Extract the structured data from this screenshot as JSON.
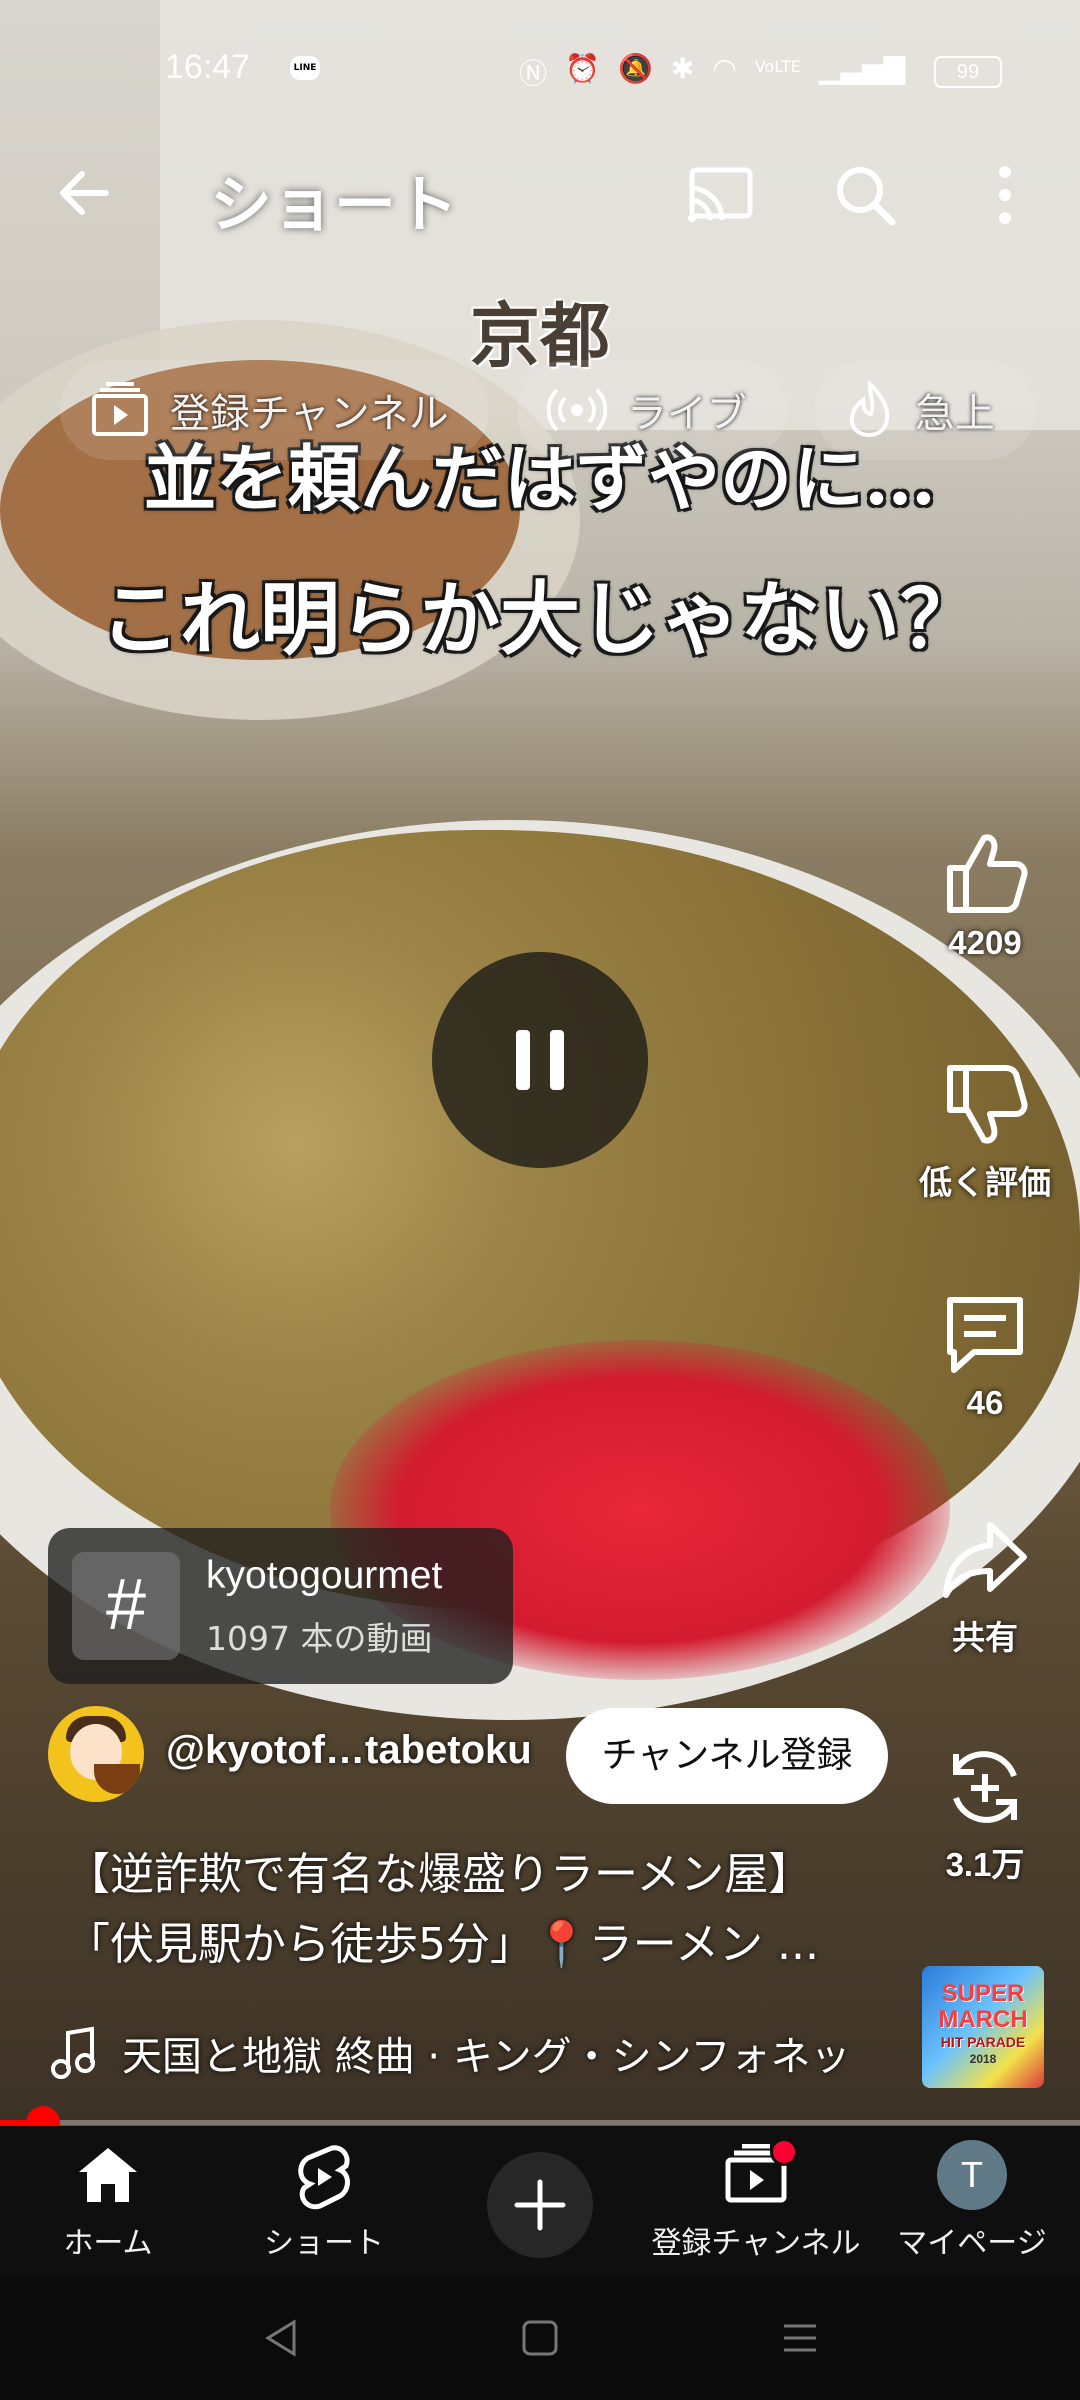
{
  "status_bar": {
    "time": "16:47",
    "line_icon_text": "LINE",
    "network": "VoLTE",
    "battery": "99"
  },
  "header": {
    "title": "ショート"
  },
  "chips": [
    {
      "label": "登録チャンネル",
      "icon": "subscriptions-icon"
    },
    {
      "label": "ライブ",
      "icon": "live-icon"
    },
    {
      "label": "急上",
      "icon": "trending-icon"
    }
  ],
  "video": {
    "caption_1": "京都",
    "caption_2": "並を頼んだはずやのに…",
    "caption_3": "これ明らか大じゃない？"
  },
  "actions": {
    "like_count": "4209",
    "dislike_label": "低く評価",
    "comment_count": "46",
    "share_label": "共有",
    "remix_count": "3.1万"
  },
  "hashtag": {
    "symbol": "#",
    "name": "kyotogourmet",
    "count": "1097 本の動画"
  },
  "channel": {
    "handle": "@kyotof…tabetoku",
    "subscribe_label": "チャンネル登録"
  },
  "description": {
    "line_1": "【逆詐欺で有名な爆盛りラーメン屋】",
    "line_2": "「伏見駅から徒歩5分」📍ラーメン ..."
  },
  "music": {
    "track": "天国と地獄 終曲 · キング・シンフォネッ",
    "album_line_1": "SUPER",
    "album_line_2": "MARCH",
    "album_line_3": "HIT PARADE",
    "album_line_4": "2018"
  },
  "progress": {
    "fraction": 0.04
  },
  "bottom_nav": {
    "home": "ホーム",
    "shorts": "ショート",
    "subscriptions": "登録チャンネル",
    "me": "マイページ",
    "me_initial": "T"
  },
  "colors": {
    "accent": "#ff0000",
    "nav_bg": "#0f0f0f"
  }
}
